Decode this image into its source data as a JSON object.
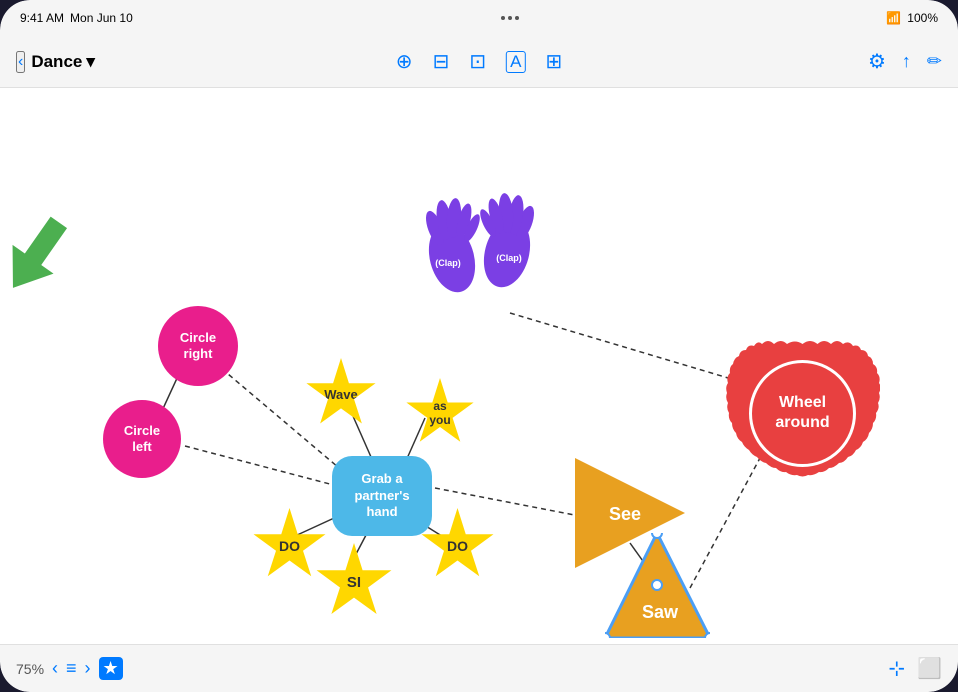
{
  "statusBar": {
    "time": "9:41 AM",
    "date": "Mon Jun 10",
    "dots": 3,
    "wifi": "wifi",
    "battery": "100%"
  },
  "toolbar": {
    "back": "‹",
    "title": "Dance",
    "chevron": "▾",
    "icons": {
      "shape": "⊕",
      "table": "⊟",
      "media": "⊞",
      "text": "A",
      "image": "⊡",
      "settings": "⚙",
      "share": "↑",
      "edit": "✏"
    }
  },
  "canvas": {
    "nodes": {
      "circleRight": "Circle\nright",
      "circleLeft": "Circle\nleft",
      "wave": "Wave",
      "asYou": "as\nyou",
      "center": "Grab a\npartner's\nhand",
      "do1": "DO",
      "do2": "DO",
      "si": "SI",
      "wheelAround": "Wheel\naround",
      "see": "See",
      "saw": "Saw",
      "clap1": "(Clap)",
      "clap2": "(Clap)"
    }
  },
  "bottomBar": {
    "zoom": "75%",
    "prevArrow": "‹",
    "list": "≡",
    "nextArrow": "›",
    "star": "★",
    "distribute": "⊹",
    "fullscreen": "⬜"
  }
}
